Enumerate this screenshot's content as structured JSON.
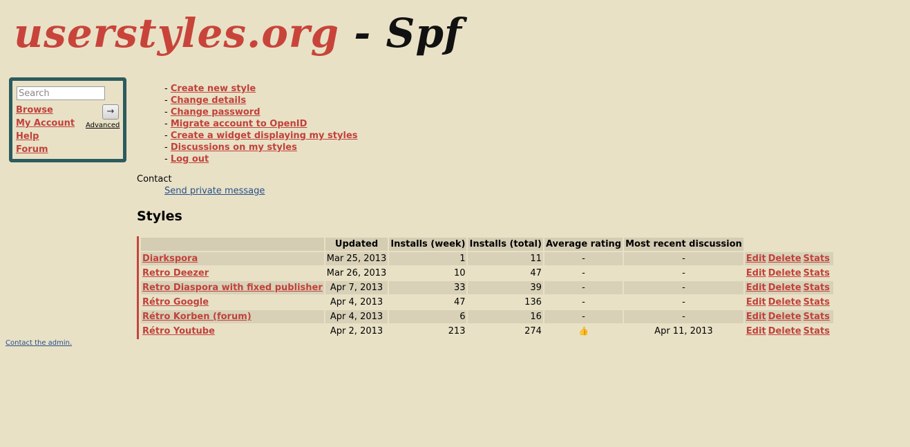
{
  "logo": {
    "site": "userstyles.org",
    "separator": " - ",
    "user": "Spf"
  },
  "sidebar": {
    "search_placeholder": "Search",
    "go_label": "→",
    "advanced_label": "Advanced",
    "links": [
      "Browse",
      "My Account",
      "Help",
      "Forum"
    ]
  },
  "menu": [
    "Create new style",
    "Change details",
    "Change password",
    "Migrate account to OpenID",
    "Create a widget displaying my styles",
    "Discussions on my styles",
    "Log out"
  ],
  "menu_prefix": "- ",
  "contact": {
    "heading": "Contact",
    "link": "Send private message"
  },
  "styles": {
    "heading": "Styles",
    "columns": [
      "",
      "Updated",
      "Installs (week)",
      "Installs (total)",
      "Average rating",
      "Most recent discussion"
    ],
    "rows": [
      {
        "name": "Diarkspora",
        "updated": "Mar 25, 2013",
        "week": "1",
        "total": "11",
        "rating": "-",
        "discussion": "-"
      },
      {
        "name": "Retro Deezer",
        "updated": "Mar 26, 2013",
        "week": "10",
        "total": "47",
        "rating": "-",
        "discussion": "-"
      },
      {
        "name": "Retro Diaspora with fixed publisher",
        "updated": "Apr 7, 2013",
        "week": "33",
        "total": "39",
        "rating": "-",
        "discussion": "-"
      },
      {
        "name": "Rétro Google",
        "updated": "Apr 4, 2013",
        "week": "47",
        "total": "136",
        "rating": "-",
        "discussion": "-"
      },
      {
        "name": "Rétro Korben (forum)",
        "updated": "Apr 4, 2013",
        "week": "6",
        "total": "16",
        "rating": "-",
        "discussion": "-"
      },
      {
        "name": "Rétro Youtube",
        "updated": "Apr 2, 2013",
        "week": "213",
        "total": "274",
        "rating": "thumbs-up-icon",
        "discussion": "Apr 11, 2013"
      }
    ],
    "actions": [
      "Edit",
      "Delete",
      "Stats"
    ]
  },
  "footer": {
    "contact_admin": "Contact the admin."
  },
  "colors": {
    "background": "#e8e1c6",
    "link": "#c1413a",
    "sidebar_border": "#2c5b5e",
    "accent_bar": "#c8443b"
  }
}
